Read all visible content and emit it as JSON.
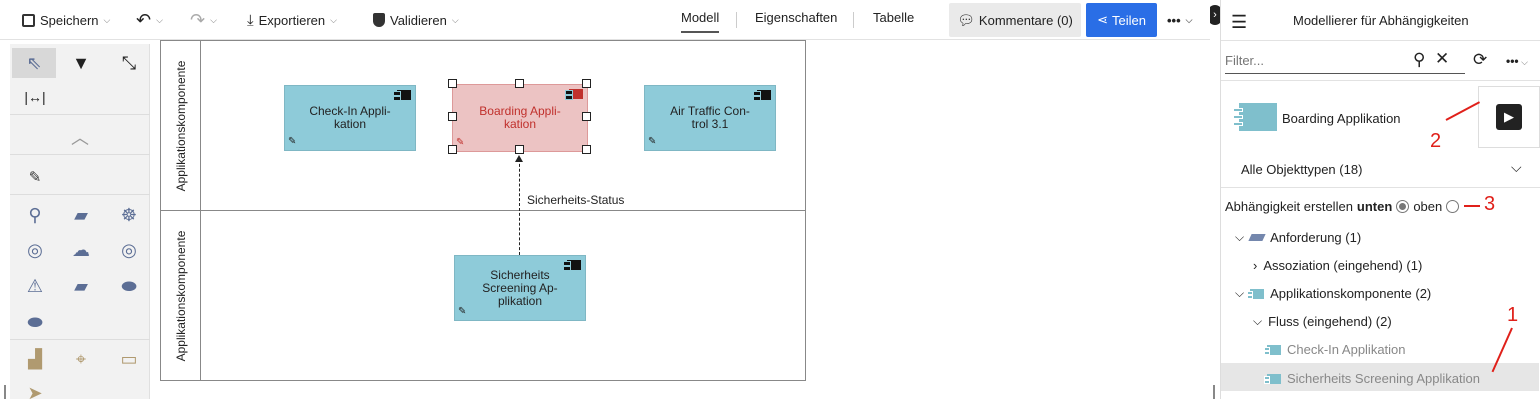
{
  "toolbar": {
    "save_label": "Speichern",
    "export_label": "Exportieren",
    "validate_label": "Validieren",
    "tabs": [
      "Modell",
      "Eigenschaften",
      "Tabelle"
    ],
    "comments_label": "Kommentare (0)",
    "share_label": "Teilen"
  },
  "canvas": {
    "lanes": [
      "Applikationskomponente",
      "Applikationskomponente"
    ],
    "nodes": {
      "checkin": "Check-In Appli-\nkation",
      "boarding": "Boarding Appli-\nkation",
      "atc": "Air Traffic Con-\ntrol 3.1",
      "security": "Sicherheits\nScreening Ap-\nplikation"
    },
    "edge_label": "Sicherheits-Status"
  },
  "panel": {
    "title": "Modellierer für Abhängigkeiten",
    "filter_placeholder": "Filter...",
    "selected_object": "Boarding Applikation",
    "object_types": "Alle Objekttypen (18)",
    "create_label": "Abhängigkeit erstellen",
    "option_down": "unten",
    "option_up": "oben",
    "tree": {
      "requirement": "Anforderung (1)",
      "association": "Assoziation (eingehend) (1)",
      "appcomp": "Applikationskomponente (2)",
      "flow": "Fluss (eingehend) (2)",
      "leaf1": "Check-In Applikation",
      "leaf2": "Sicherheits Screening Applikation"
    },
    "annotations": [
      "1",
      "2",
      "3"
    ]
  },
  "colors": {
    "accent": "#2a6ee6",
    "node": "#8ecbd9",
    "selected_node": "#ecc3c3",
    "annotation": "#e0201a"
  }
}
